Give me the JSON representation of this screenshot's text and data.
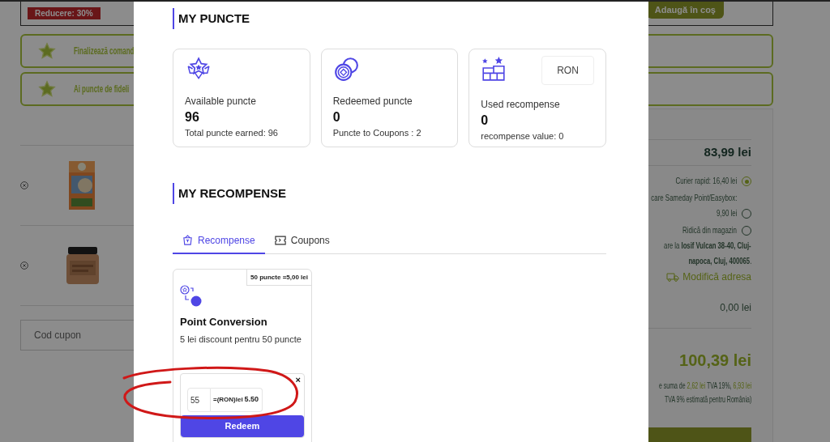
{
  "background_page": {
    "product_banner": {
      "discount_badge": "Reducere: 30%",
      "add_to_cart_button": "Adaugă în coş"
    },
    "notices": [
      {
        "text": "Finalizează comand"
      },
      {
        "text": "Ai puncte de fideli"
      }
    ],
    "cart_table": {
      "rows": [
        {
          "kind": "box"
        },
        {
          "kind": "jar"
        }
      ]
    },
    "coupon_field": {
      "placeholder": "Cod cupon"
    },
    "summary": {
      "subtotal": "83,99 lei",
      "shipping_options": [
        {
          "lines": [
            "Curier rapid: 16,40 lei"
          ],
          "selected": true
        },
        {
          "lines": [
            "care Sameday Point/Easybox:",
            "9,90 lei"
          ],
          "selected": false
        },
        {
          "lines": [
            "Ridică din magazin"
          ],
          "selected": false
        }
      ],
      "address_lines": [
        "are la **Iosif Vulcan 38-40, Cluj-**",
        "**napoca, Cluj, 400065**."
      ],
      "change_address_link": "Modifică adresa",
      "discount": "0,00 lei",
      "total": "100,39 lei",
      "vat_note_lines": [
        "e suma de **2,62 lei** TVA 19%, **6,93 lei**",
        "TVA 9% estimată pentru România)"
      ]
    }
  },
  "modal": {
    "points": {
      "heading": "MY PUNCTE",
      "cards": [
        {
          "kind": "available",
          "label": "Available puncte",
          "value": "96",
          "note": "Total puncte earned: 96"
        },
        {
          "kind": "redeemed",
          "label": "Redeemed puncte",
          "value": "0",
          "note": "Puncte to Coupons : 2"
        },
        {
          "kind": "used",
          "label": "Used recompense",
          "value": "0",
          "note": "recompense value: 0",
          "currency": "RON"
        }
      ]
    },
    "rewards": {
      "heading": "MY RECOMPENSE",
      "tabs": [
        {
          "kind": "rewards",
          "label": "Recompense",
          "selected": true
        },
        {
          "kind": "coupons",
          "label": "Coupons",
          "selected": false
        }
      ],
      "cards": [
        {
          "badge": "50 puncte =5,00 lei",
          "title": "Point Conversion",
          "description": "5 lei discount pentru 50 puncte",
          "redeem_form": {
            "close": "×",
            "points_value": "55",
            "conversion_label": "=(RON)lei",
            "amount": "5.50",
            "button": "Redeem"
          }
        }
      ]
    }
  }
}
